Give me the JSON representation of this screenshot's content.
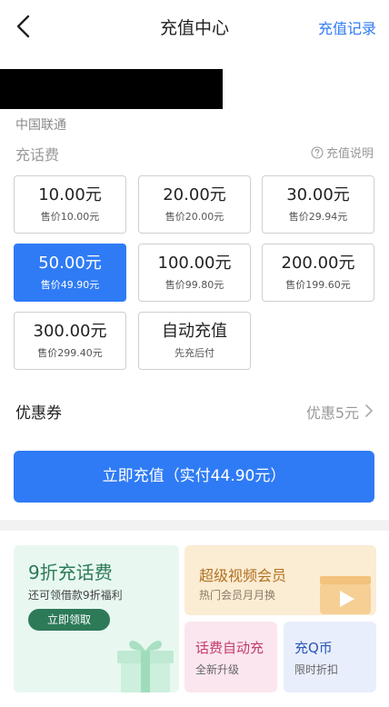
{
  "header": {
    "title": "充值中心",
    "history_label": "充值记录",
    "back_icon": "back-arrow-icon"
  },
  "account": {
    "carrier": "中国联通"
  },
  "recharge": {
    "section_title": "充话费",
    "help_label": "充值说明",
    "options": [
      {
        "amount": "10.00元",
        "price": "售价10.00元",
        "selected": false
      },
      {
        "amount": "20.00元",
        "price": "售价20.00元",
        "selected": false
      },
      {
        "amount": "30.00元",
        "price": "售价29.94元",
        "selected": false
      },
      {
        "amount": "50.00元",
        "price": "售价49.90元",
        "selected": true
      },
      {
        "amount": "100.00元",
        "price": "售价99.80元",
        "selected": false
      },
      {
        "amount": "200.00元",
        "price": "售价199.60元",
        "selected": false
      },
      {
        "amount": "300.00元",
        "price": "售价299.40元",
        "selected": false
      },
      {
        "amount": "自动充值",
        "price": "先充后付",
        "selected": false
      }
    ]
  },
  "coupon": {
    "label": "优惠券",
    "value": "优惠5元"
  },
  "pay_button": {
    "label": "立即充值（实付44.90元）"
  },
  "promos": {
    "discount": {
      "title": "9折充话费",
      "subtitle": "还可领借款9折福利",
      "button": "立即领取"
    },
    "video": {
      "title": "超级视频会员",
      "subtitle": "热门会员月月换"
    },
    "auto_fee": {
      "title": "话费自动充",
      "subtitle": "全新升级"
    },
    "qcoin": {
      "title": "充Q币",
      "subtitle": "限时折扣"
    }
  },
  "colors": {
    "accent": "#2f7bf5",
    "promo_green": "#2d7a58",
    "promo_gold": "#b07321",
    "promo_pink": "#c23c6d",
    "promo_blue": "#2a56b8"
  }
}
